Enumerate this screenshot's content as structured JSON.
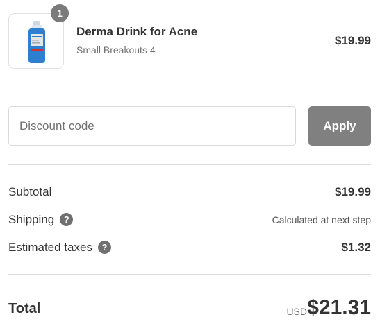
{
  "product": {
    "quantity": "1",
    "name": "Derma Drink for Acne",
    "variant": "Small Breakouts 4",
    "price": "$19.99",
    "image_icon": "bottle-icon",
    "colors": {
      "bottle": "#2f7fd1",
      "label": "#e6e6e6",
      "accent": "#d0332f"
    }
  },
  "discount": {
    "placeholder": "Discount code",
    "value": "",
    "apply_label": "Apply"
  },
  "summary": {
    "subtotal_label": "Subtotal",
    "subtotal_value": "$19.99",
    "shipping_label": "Shipping",
    "shipping_value": "Calculated at next step",
    "taxes_label": "Estimated taxes",
    "taxes_value": "$1.32",
    "help_glyph": "?"
  },
  "total": {
    "label": "Total",
    "currency": "USD",
    "value": "$21.31"
  }
}
